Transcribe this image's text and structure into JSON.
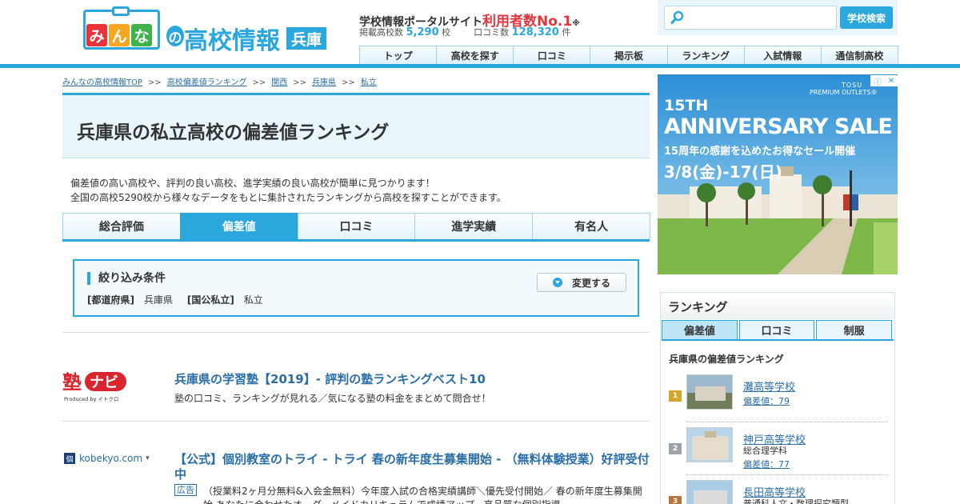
{
  "header": {
    "logo_chars": [
      "み",
      "ん",
      "な"
    ],
    "logo_colors": [
      "#e8333a",
      "#f5a623",
      "#3cb44b"
    ],
    "logo_no": "の",
    "logo_title": "高校情報",
    "logo_region": "兵庫",
    "tagline_prefix": "学校情報ポータルサイト",
    "tagline_highlight": "利用者数No.1",
    "tagline_mark": "※",
    "stats_schools_label": "掲載高校数",
    "stats_schools_value": "5,290",
    "stats_schools_unit": "校",
    "stats_reviews_label": "口コミ数",
    "stats_reviews_value": "128,320",
    "stats_reviews_unit": "件",
    "search_placeholder": "",
    "search_button": "学校検索",
    "nav": [
      "トップ",
      "高校を探す",
      "口コミ",
      "掲示板",
      "ランキング",
      "入試情報",
      "通信制高校"
    ]
  },
  "breadcrumb": [
    "みんなの高校情報TOP",
    "高校偏差値ランキング",
    "関西",
    "兵庫県",
    "私立"
  ],
  "breadcrumb_sep": ">>",
  "page_title": "兵庫県の私立高校の偏差値ランキング",
  "description": [
    "偏差値の高い高校や、評判の良い高校、進学実績の良い高校が簡単に見つかります！",
    "全国の高校5290校から様々なデータをもとに集計されたランキングから高校を探すことができます。"
  ],
  "tabs": [
    {
      "label": "総合評価",
      "active": false
    },
    {
      "label": "偏差値",
      "active": true
    },
    {
      "label": "口コミ",
      "active": false
    },
    {
      "label": "進学実績",
      "active": false
    },
    {
      "label": "有名人",
      "active": false
    }
  ],
  "filter": {
    "title": "絞り込み条件",
    "change_button": "変更する",
    "conditions": [
      {
        "label": "[都道府県]",
        "value": "兵庫県"
      },
      {
        "label": "[国公私立]",
        "value": "私立"
      }
    ]
  },
  "ads": [
    {
      "logo_main": "塾ナビ",
      "logo_sub": "Produced by イトクロ",
      "title": "兵庫県の学習塾【2019】- 評判の塾ランキングベスト10",
      "text": "塾の口コミ、ランキングが見れる／気になる塾の料金をまとめて問合せ！"
    },
    {
      "source": "kobekyo.com",
      "source_caret": "▾",
      "title": "【公式】個別教室のトライ - トライ 春の新年度生募集開始 - （無料体験授業）好評受付中",
      "badge": "広告",
      "text": "（授業料2ヶ月分無料&入会金無料）今年度入試の合格実績講師＼優先受付開始／ 春の新年度生募集開始 あなたに合わせたオーダーメイドカリキュラムで成績アップ。高品質な個別指導。"
    }
  ],
  "banner": {
    "brand1": "TOSU",
    "brand2": "PREMIUM OUTLETS®",
    "line1": "15TH",
    "line2": "ANNIVERSARY SALE",
    "line3": "15周年の感謝を込めたお得なセール開催",
    "line4": "3/8(金)-17(日)"
  },
  "ranking": {
    "heading": "ランキング",
    "tabs": [
      {
        "label": "偏差値",
        "active": true
      },
      {
        "label": "口コミ",
        "active": false
      },
      {
        "label": "制服",
        "active": false
      }
    ],
    "subheading": "兵庫県の偏差値ランキング",
    "items": [
      {
        "rank": "1",
        "name": "灘高等学校",
        "detail": "偏差値：79",
        "medal_color": "#d4a72c"
      },
      {
        "rank": "2",
        "name": "神戸高等学校",
        "dept": "総合理学科",
        "detail": "偏差値：77",
        "medal_color": "#9ea3a8"
      },
      {
        "rank": "3",
        "name": "長田高等学校",
        "dept": "普通科人文・数理探究類型",
        "detail": "",
        "medal_color": "#b8733a"
      }
    ]
  },
  "colors": {
    "accent": "#2aa7dc",
    "link": "#2a6ea8",
    "highlight": "#e8333a"
  }
}
